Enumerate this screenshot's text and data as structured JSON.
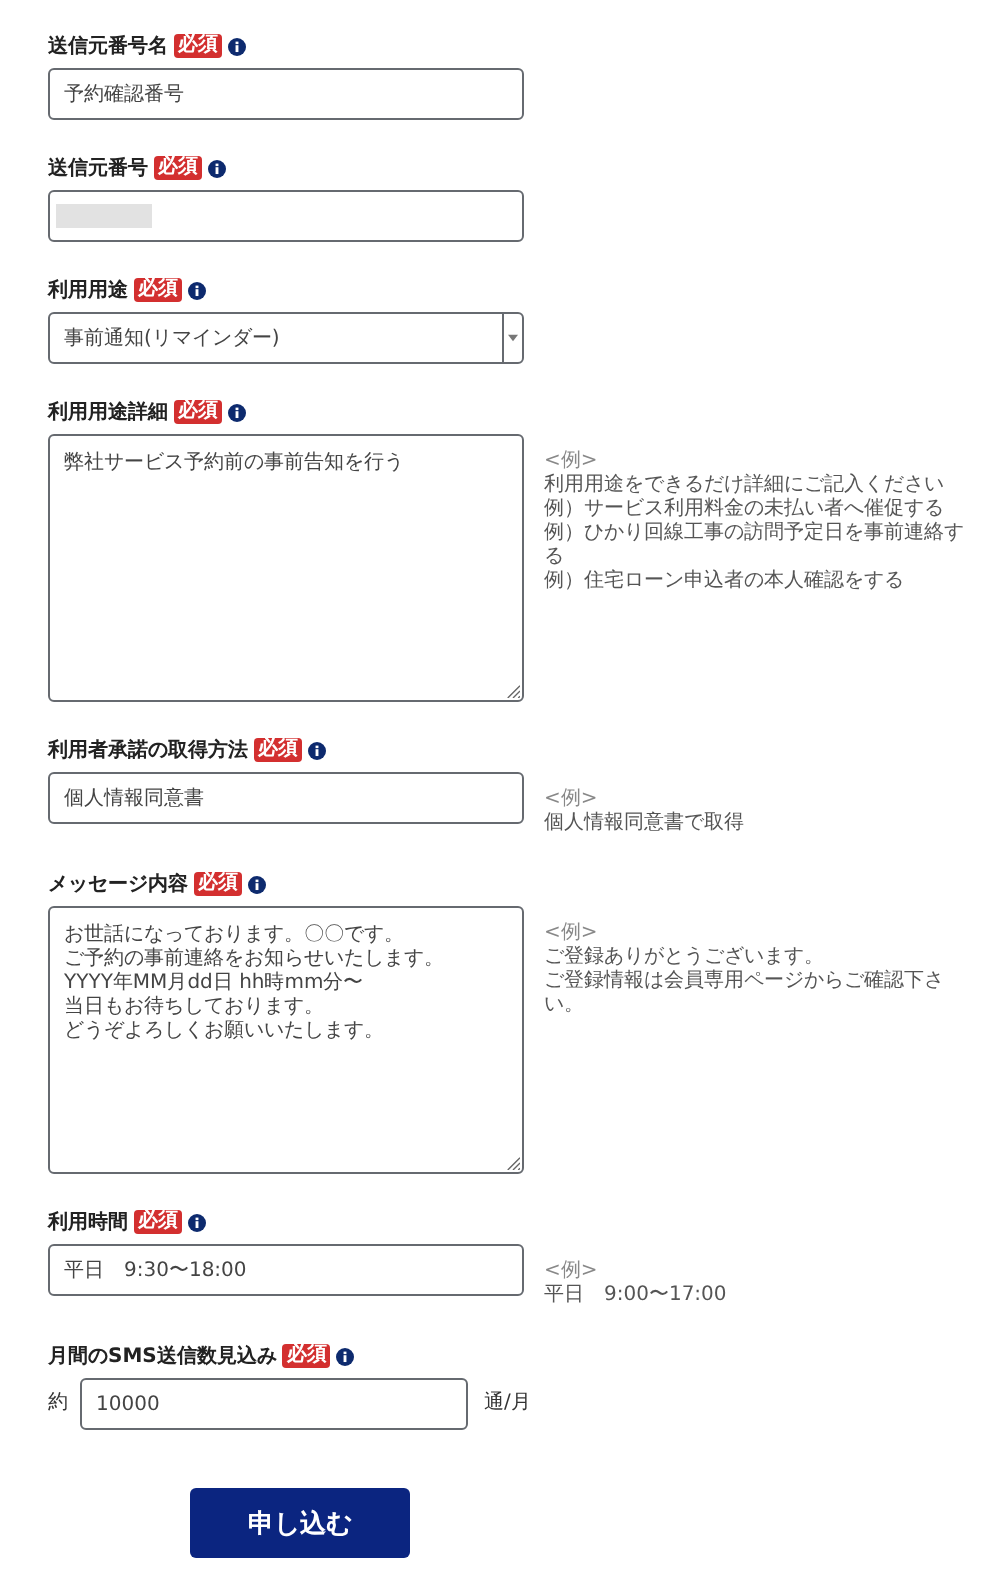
{
  "fields": [
    {
      "label": "送信元番号名",
      "badge": "必須",
      "kind": "text",
      "value": "予約確認番号"
    },
    {
      "label": "送信元番号",
      "badge": "必須",
      "kind": "masked"
    },
    {
      "label": "利用用途",
      "badge": "必須",
      "kind": "select",
      "value": "事前通知(リマインダー)"
    },
    {
      "label": "利用用途詳細",
      "badge": "必須",
      "kind": "textarea",
      "value": "弊社サービス予約前の事前告知を行う",
      "hint": [
        "<例>",
        "利用用途をできるだけ詳細にご記入ください",
        "例）サービス利用料金の未払い者へ催促する",
        "例）ひかり回線工事の訪問予定日を事前連絡する",
        "例）住宅ローン申込者の本人確認をする"
      ]
    },
    {
      "label": "利用者承諾の取得方法",
      "badge": "必須",
      "kind": "text",
      "value": "個人情報同意書",
      "hint": [
        "<例>",
        "個人情報同意書で取得"
      ]
    },
    {
      "label": "メッセージ内容",
      "badge": "必須",
      "kind": "textarea",
      "lines": [
        "お世話になっております。〇〇です。",
        "ご予約の事前連絡をお知らせいたします。",
        "YYYY年MM月dd日 hh時mm分〜",
        "当日もお待ちしております。",
        "どうぞよろしくお願いいたします。"
      ],
      "hint": [
        "<例>",
        "ご登録ありがとうございます。",
        "ご登録情報は会員専用ページからご確認下さい。"
      ]
    },
    {
      "label": "利用時間",
      "badge": "必須",
      "kind": "text",
      "value": "平日　9:30〜18:00",
      "hint": [
        "<例>",
        "平日　9:00〜17:00"
      ]
    },
    {
      "label": "月間のSMS送信数見込み",
      "badge": "必須",
      "kind": "amount",
      "prefix": "約",
      "value": "10000",
      "suffix": "通/月"
    }
  ],
  "submit": "申し込む"
}
